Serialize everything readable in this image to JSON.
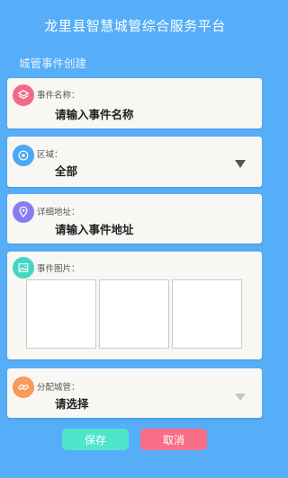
{
  "header": {
    "title": "龙里县智慧城管综合服务平台"
  },
  "section": {
    "title": "城管事件创建"
  },
  "fields": {
    "event_name": {
      "label": "事件名称：",
      "placeholder": "请输入事件名称",
      "icon": "layers-icon",
      "color": "#f06b8a"
    },
    "region": {
      "label": "区域：",
      "value": "全部",
      "icon": "target-icon",
      "color": "#4aa8f5"
    },
    "address": {
      "label": "详细地址：",
      "placeholder": "请输入事件地址",
      "icon": "location-pin-icon",
      "color": "#8a7cf0"
    },
    "images": {
      "label": "事件图片：",
      "icon": "image-icon",
      "color": "#45d6c2"
    },
    "officer": {
      "label": "分配城管：",
      "value": "请选择",
      "icon": "link-icon",
      "color": "#f79a5a"
    }
  },
  "buttons": {
    "save": {
      "label": "保存",
      "color": "#4ee5cc"
    },
    "cancel": {
      "label": "取消",
      "color": "#f76e86"
    }
  }
}
